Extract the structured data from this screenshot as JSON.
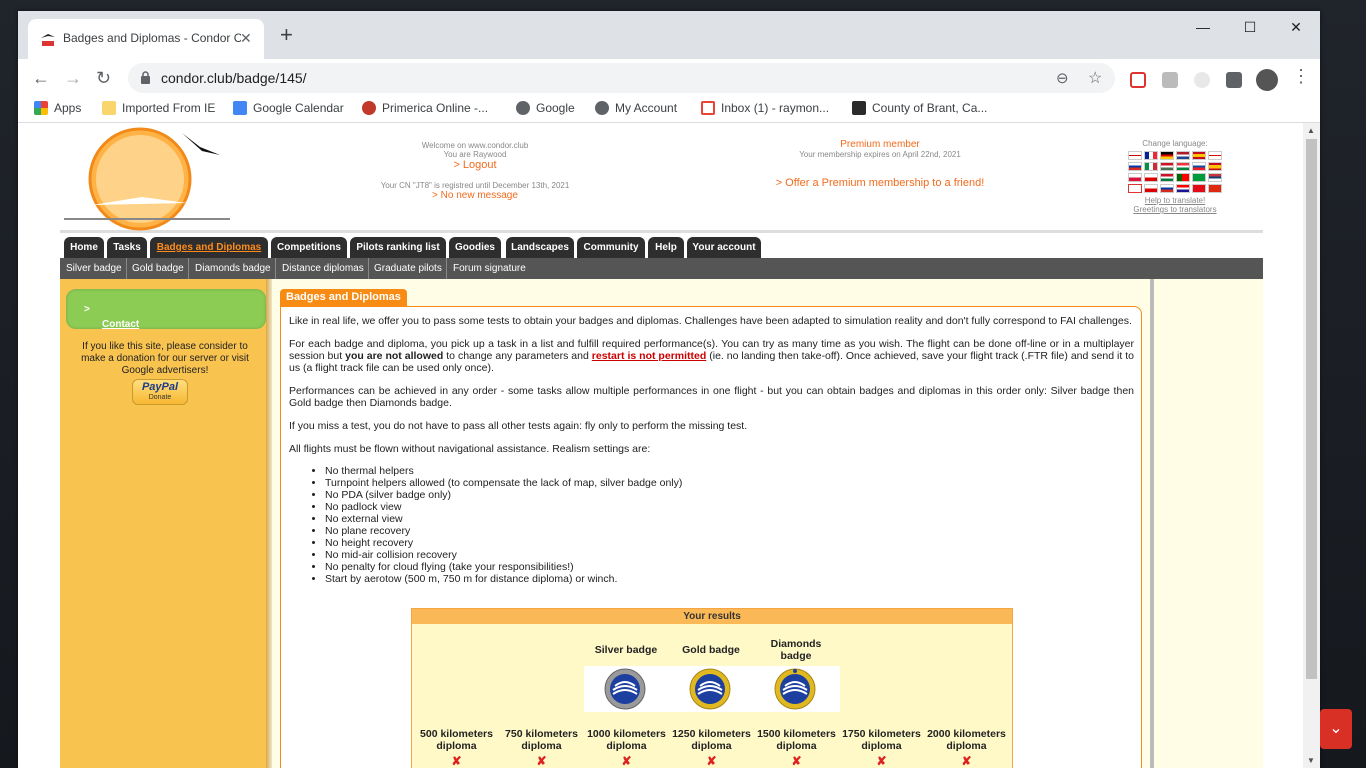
{
  "browser": {
    "tab_title": "Badges and Diplomas - Condor Club",
    "url": "condor.club/badge/145/",
    "bookmarks": [
      {
        "label": "Apps",
        "color": "#ea4335"
      },
      {
        "label": "Imported From IE",
        "color": "#f9d56e"
      },
      {
        "label": "Google Calendar",
        "color": "#4285f4"
      },
      {
        "label": "Primerica Online -...",
        "color": "#c0392b"
      },
      {
        "label": "Google",
        "color": "#5f6368"
      },
      {
        "label": "My Account",
        "color": "#5f6368"
      },
      {
        "label": "Inbox (1) - raymon...",
        "color": "#ea4335"
      },
      {
        "label": "County of Brant, Ca...",
        "color": "#2b2b2b"
      }
    ]
  },
  "header": {
    "welcome": "Welcome on www.condor.club",
    "you_are": "You are Raywood",
    "logout": "> Logout",
    "cn_line": "Your CN \"JT8\" is registred until December 13th, 2021",
    "no_message": "> No new message",
    "premium_title": "Premium member",
    "premium_expires": "Your membership expires on April 22nd, 2021",
    "offer": "> Offer a Premium membership to a friend!",
    "change_language": "Change language:",
    "help_translate": "Help to translate!",
    "greetings": "Greetings to translators"
  },
  "menu": {
    "main": [
      "Home",
      "Tasks",
      "Badges and Diplomas",
      "Competitions",
      "Pilots ranking list",
      "Goodies",
      "Landscapes",
      "Community",
      "Help",
      "Your account"
    ],
    "sub": [
      "Silver badge",
      "Gold badge",
      "Diamonds badge",
      "Distance diplomas",
      "Graduate pilots",
      "Forum signature"
    ]
  },
  "left": {
    "contact": "Contact",
    "donate_text": "If you like this site, please consider to make a donation for our server or visit Google advertisers!",
    "paypal": "PayPal",
    "donate": "Donate"
  },
  "main": {
    "box_title": "Badges and Diplomas",
    "p1": "Like in real life, we offer you to pass some tests to obtain your badges and diplomas. Challenges have been adapted to simulation reality and don't fully correspond to FAI challenges.",
    "p2a": "For each badge and diploma, you pick up a task in a list and fulfill required performance(s). You can try as many time as you wish. The flight can be done off-line or in a multiplayer session but",
    "p2b": "you are not allowed",
    "p2c": "to change any parameters and",
    "p2d": "restart is not permitted",
    "p2e": "(ie. no landing then take-off). Once achieved, save your flight track (.FTR file) and send it to us (a flight track file can be used only once).",
    "p3": "Performances can be achieved in any order - some tasks allow multiple performances in one flight - but you can obtain badges and diplomas in this order only: Silver badge then Gold badge then Diamonds badge.",
    "p4": "If you miss a test, you do not have to pass all other tests again: fly only to perform the missing test.",
    "p5": "All flights must be flown without navigational assistance. Realism settings are:",
    "rules": [
      "No thermal helpers",
      "Turnpoint helpers allowed (to compensate the lack of map, silver badge only)",
      "No PDA (silver badge only)",
      "No padlock view",
      "No external view",
      "No plane recovery",
      "No height recovery",
      "No mid-air collision recovery",
      "No penalty for cloud flying (take your responsibilities!)",
      "Start by aerotow (500 m, 750 m for distance diploma) or winch."
    ],
    "results_title": "Your results",
    "badges": [
      "Silver badge",
      "Gold badge",
      "Diamonds badge"
    ],
    "diplomas": [
      "500 kilometers diploma",
      "750 kilometers diploma",
      "1000 kilometers diploma",
      "1250 kilometers diploma",
      "1500 kilometers diploma",
      "1750 kilometers diploma",
      "2000 kilometers diploma"
    ],
    "diploma_status": "✘"
  },
  "colors": {
    "accent_orange": "#f78b14",
    "left_column": "#f9c350",
    "menu_dark": "#2e2e2e",
    "contact_green": "#8ccc55"
  }
}
